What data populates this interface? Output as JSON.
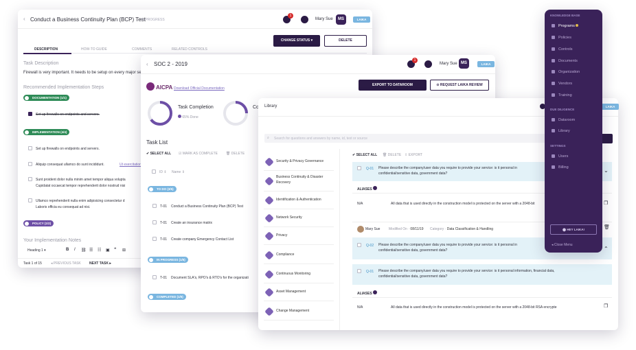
{
  "win1": {
    "back_title": "Conduct a Business Continuity Plan (BCP) Test",
    "status": "IN PROGRESS",
    "notif_count": "1",
    "user": "Mary Sue",
    "initials": "MS",
    "brand": "LAIKA",
    "change_status": "CHANGE STATUS",
    "delete": "DELETE",
    "tabs": [
      "DESCRIPTION",
      "HOW-TO GUIDE",
      "COMMENTS",
      "RELATED CONTROLS"
    ],
    "task_description_h": "Task Description",
    "task_description": "Firewall is very important. It needs to be setup on every major serv",
    "rec_steps_h": "Recommended Implementation Steps",
    "doc_pill": "DOCUMENTATION (1/1)",
    "doc_item": "Set up firewalls on endpoints and servers.",
    "impl_pill": "IMPLEMENTATION (4/4)",
    "impl_items": [
      "Set up firewalls on endpoints and servers.",
      "Aliquip consequat ullamco do sunt incididunt.",
      "Sunt proident dolor nulla minim amet tempor aliqua volupta",
      "Ullamco reprehenderit nulla enim adipisicing consectetur d"
    ],
    "impl_item2_link": "Ut exercitation",
    "impl_item3_line2": "Cupidatat occaecat tempor reprehenderit dolor nostrud nisi",
    "impl_item4_line2": "Laboris officia eu consequat ad nisi.",
    "policy_pill": "POLICY (1/2)",
    "notes_h": "Your Implementation Notes",
    "heading_select": "Heading 1",
    "footer_count": "Task 1 of 15",
    "prev_task": "PREVIOUS TASK",
    "next_task": "NEXT TASK"
  },
  "win2": {
    "title": "SOC 2 - 2019",
    "notif_count": "1",
    "user": "Mary Sue",
    "initials": "MS",
    "brand": "LAIKA",
    "aicpa": "AICPA",
    "download_link": "Download Official Documentation",
    "export_btn": "EXPORT TO DATAROOM",
    "review_btn": "REQUEST LAIKA REVIEW",
    "completion_label": "Task Completion",
    "completion_value": "65% Done",
    "completion_pct": 65,
    "second_label": "Co",
    "task_list_h": "Task List",
    "select_all": "SELECT ALL",
    "mark_complete": "MARK AS COMPLETE",
    "delete": "DELETE",
    "col_id": "ID",
    "col_name": "Name",
    "todo_pill": "TO DO (3/5)",
    "todo_rows": [
      {
        "id": "T-01",
        "name": "Conduct a Business Continuity Plan (BCP) Test"
      },
      {
        "id": "T-01",
        "name": "Create an insurance matrix"
      },
      {
        "id": "T-01",
        "name": "Create company Emergency Contact List"
      }
    ],
    "inprog_pill": "IN PROGRESS (1/5)",
    "inprog_rows": [
      {
        "id": "T-01",
        "name": "Document SLA's, RPO's & RTO's for the organizati"
      }
    ],
    "completed_pill": "COMPLETED (1/5)"
  },
  "win3": {
    "title": "Library",
    "search_placeholder": "Search for questions and answers by name, id, text or source",
    "categories": [
      "Security & Privacy Governance",
      "Business Continuity & Disaster Recovery",
      "Identification & Authentication",
      "Network Security",
      "Privacy",
      "Compliance",
      "Continuous Monitoring",
      "Asset Management",
      "Change Management"
    ],
    "select_all": "SELECT ALL",
    "delete": "DELETE",
    "export": "EXPORT",
    "q1_id": "Q-01",
    "q1_text": "Please describe the company/user data you require to provide your service: is it personal in confidential/sensitive data, government data?",
    "aliases": "ALIASES",
    "na": "N/A",
    "answer1": "All data that is used directly in the construction model is protected on the server with a 2048-bit",
    "meta_user": "Mary Sue",
    "meta_modified_label": "Modified On",
    "meta_modified": "08/11/19",
    "meta_category_label": "Category",
    "meta_category": "Data Classification & Handling",
    "q2_id": "Q-02",
    "q2_text": "Please describe the company/user data you require to provide your service: is it personal in confidential/sensitive data, government data?",
    "q3_id": "Q-01",
    "q3_text": "Please describe the company/user data you require to provide your service: is it personal information, financial data, confidential/sensitive data, government data?",
    "answer3": "All data that is used directly in the construction model is protected on the server with a 2048-bit RSA encrypte"
  },
  "sidebar": {
    "sec1": "KNOWLEDGE BASE",
    "items1": [
      "Programs",
      "Policies",
      "Controls",
      "Documents",
      "Organization",
      "Vendors",
      "Training"
    ],
    "sec2": "DUE DILIGENCE",
    "items2": [
      "Dataroom",
      "Library"
    ],
    "sec3": "SETTINGS",
    "items3": [
      "Users",
      "Billing"
    ],
    "hey_laika": "HEY LAIKA!",
    "close_menu": "Close Menu",
    "laika_tag": "LAIKA",
    "accent": "#3a2259"
  }
}
